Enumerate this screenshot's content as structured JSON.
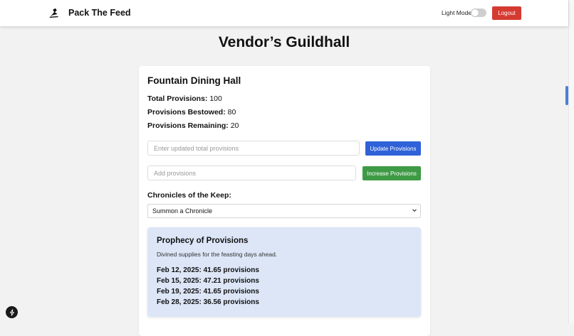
{
  "nav": {
    "brand": "Pack The Feed",
    "mode_label": "Light Mode",
    "logout_label": "Logout",
    "logo_icon": "bird-icon"
  },
  "page": {
    "title": "Vendor’s Guildhall"
  },
  "card": {
    "title": "Fountain Dining Hall",
    "stats": [
      {
        "label": "Total Provisions:",
        "value": "100"
      },
      {
        "label": "Provisions Bestowed:",
        "value": "80"
      },
      {
        "label": "Provisions Remaining:",
        "value": "20"
      }
    ],
    "update_input": {
      "placeholder": "Enter updated total provisions",
      "value": ""
    },
    "update_button": "Update Provisions",
    "add_input": {
      "placeholder": "Add provisions",
      "value": ""
    },
    "increase_button": "Increase Provisions",
    "chronicles_label": "Chronicles of the Keep:",
    "chronicles_select": "Summon a Chronicle"
  },
  "prophecy": {
    "title": "Prophecy of Provisions",
    "subtitle": "Divined supplies for the feasting days ahead.",
    "forecasts": [
      "Feb 12, 2025: 41.65 provisions",
      "Feb 15, 2025: 47.21 provisions",
      "Feb 19, 2025: 41.65 provisions",
      "Feb 28, 2025: 36.56 provisions"
    ]
  },
  "colors": {
    "logout": "#d53a31",
    "update_button": "#2f62d9",
    "increase_button": "#3e9a45",
    "prophecy_bg": "#dce6f7"
  }
}
